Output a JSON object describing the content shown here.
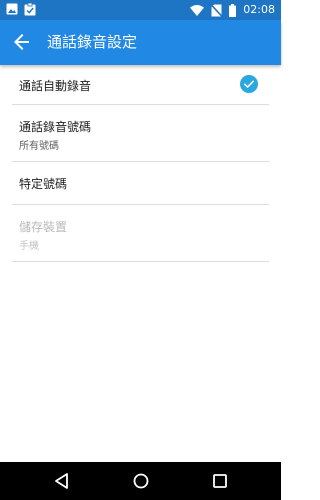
{
  "status_bar": {
    "time": "02:08",
    "icons": [
      "image-icon",
      "clipboard-check-icon",
      "wifi-icon",
      "no-sim-icon",
      "battery-icon"
    ]
  },
  "app_bar": {
    "title": "通話錄音設定",
    "back_icon": "arrow-back-icon"
  },
  "settings": {
    "auto_record": {
      "title": "通話自動錄音",
      "checked": true
    },
    "record_numbers": {
      "title": "通話錄音號碼",
      "subtitle": "所有號碼"
    },
    "specific_numbers": {
      "title": "特定號碼"
    },
    "storage": {
      "title": "儲存裝置",
      "subtitle": "手機",
      "enabled": false
    }
  },
  "nav_bar": {
    "icons": [
      "back-triangle-icon",
      "home-circle-icon",
      "recents-square-icon"
    ]
  },
  "colors": {
    "status_bar": "#1e75c4",
    "app_bar": "#2189e3",
    "accent": "#29a8e0",
    "divider": "#dcdcdc"
  }
}
